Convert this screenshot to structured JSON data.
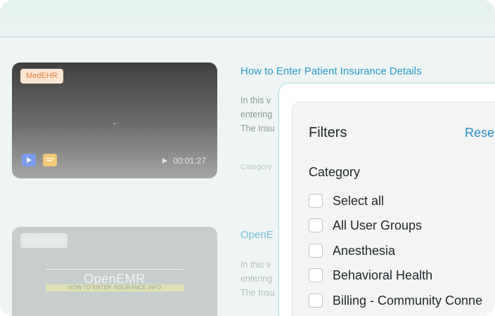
{
  "videos": [
    {
      "badge": "MedEHR",
      "duration": "00:01:27",
      "title": "How to Enter Patient Insurance Details",
      "desc_lines": [
        "In this v",
        "entering",
        "The Insu"
      ],
      "meta": "Category"
    },
    {
      "badge": "OpenEMR",
      "thumb_title": "OpenEMR",
      "thumb_subtitle": "HOW TO ENTER INSURANCE INFO",
      "title": "OpenE",
      "desc_lines": [
        "In this v",
        "entering",
        "The Insu"
      ]
    }
  ],
  "filters": {
    "title": "Filters",
    "reset_label": "Rese",
    "category_title": "Category",
    "options": [
      "Select all",
      "All User Groups",
      "Anesthesia",
      "Behavioral Health",
      "Billing - Community Conne"
    ]
  },
  "colors": {
    "accent": "#2d9bc9",
    "modal_border": "#b8dfe0"
  }
}
